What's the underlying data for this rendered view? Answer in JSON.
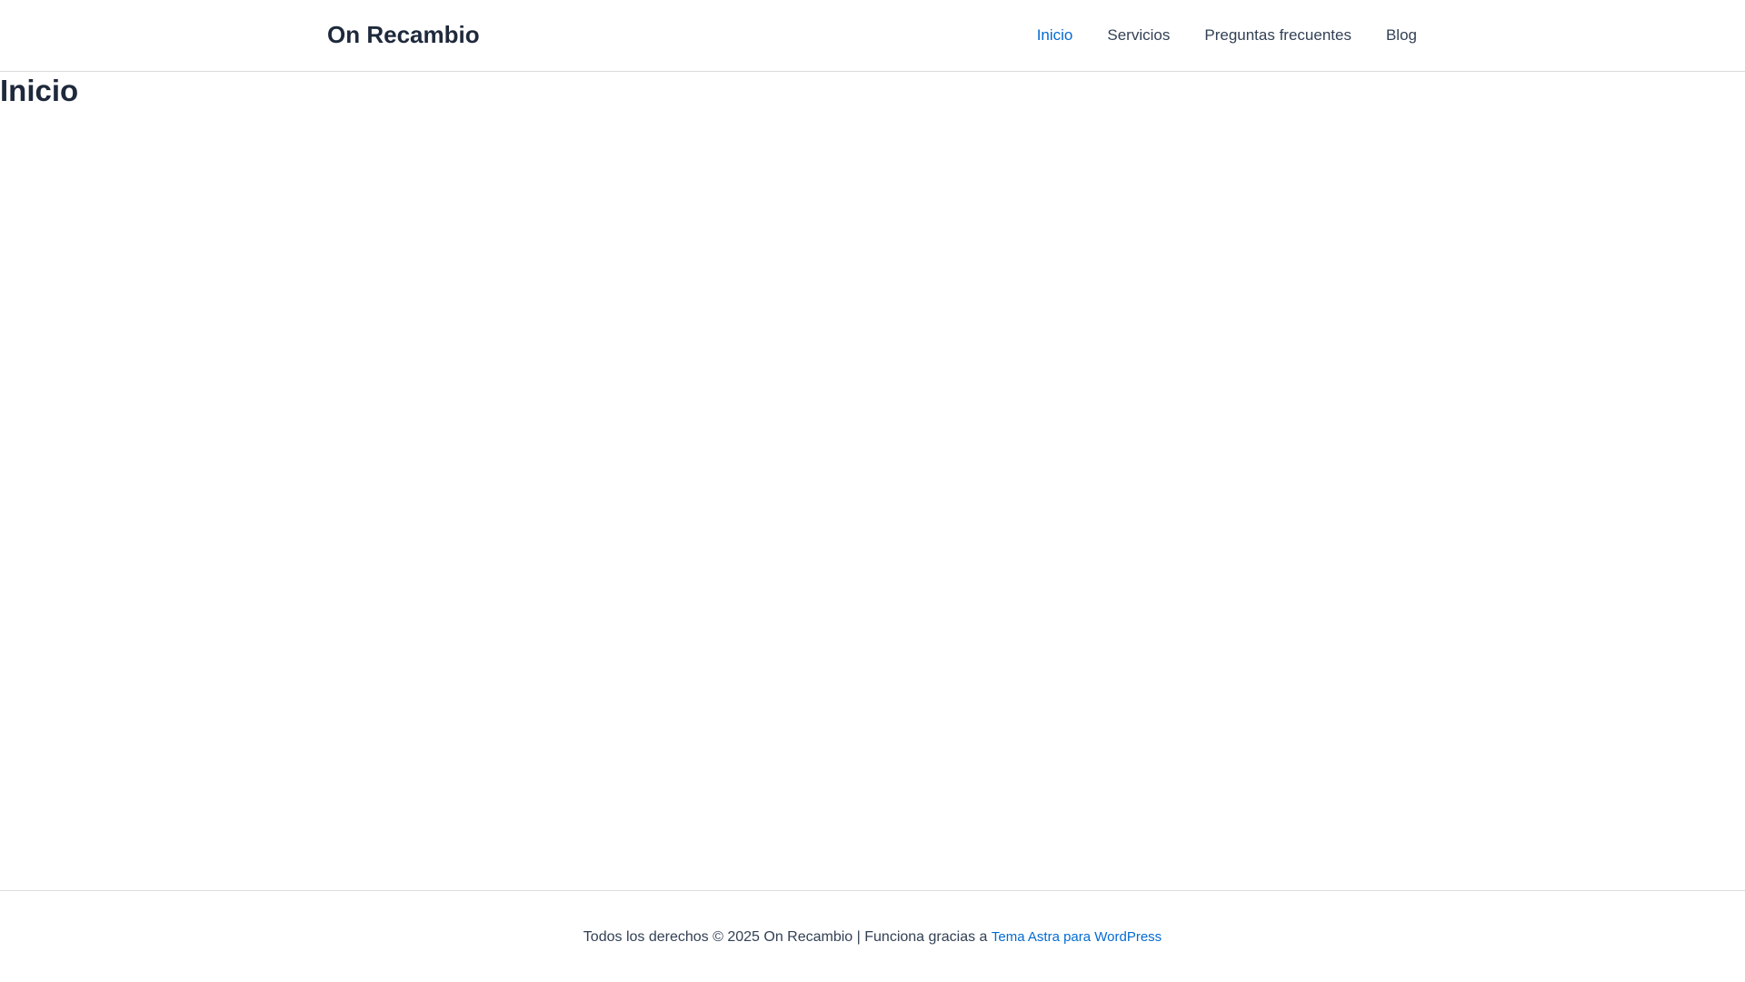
{
  "header": {
    "site_title": "On Recambio",
    "nav": [
      {
        "label": "Inicio",
        "active": true
      },
      {
        "label": "Servicios",
        "active": false
      },
      {
        "label": "Preguntas frecuentes",
        "active": false
      },
      {
        "label": "Blog",
        "active": false
      }
    ]
  },
  "main": {
    "page_title": "Inicio"
  },
  "footer": {
    "copyright_text": "Todos los derechos © 2025 On Recambio | Funciona gracias a",
    "theme_link_label": "Tema Astra para WordPress"
  },
  "colors": {
    "accent": "#046bd2",
    "text": "#334155",
    "heading": "#1e293b",
    "border": "#dcdcdc"
  }
}
